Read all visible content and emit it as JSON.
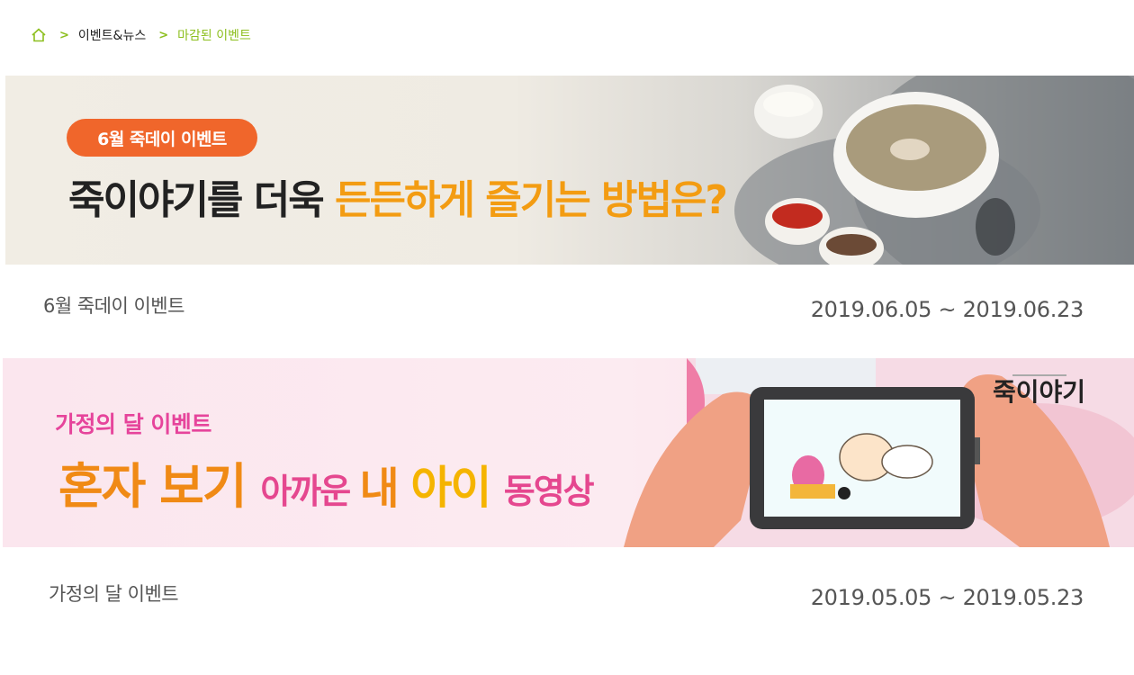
{
  "breadcrumb": {
    "home_icon": "home-icon",
    "items": [
      "이벤트&뉴스",
      "마감된 이벤트"
    ]
  },
  "events": [
    {
      "banner": {
        "pill": "6월 죽데이 이벤트",
        "headline_dark": "죽이야기를 더욱 ",
        "headline_accent": "든든하게 즐기는 방법은?"
      },
      "title": "6월 죽데이 이벤트",
      "period": "2019.06.05 ~ 2019.06.23"
    },
    {
      "banner": {
        "subtitle": "가정의 달 이벤트",
        "h1": "혼자 보기 ",
        "h2": "아까운 ",
        "h3": "내 ",
        "h4": "아이 ",
        "h5": "동영상",
        "logo": "죽이야기"
      },
      "title": "가정의 달 이벤트",
      "period": "2019.05.05 ~ 2019.05.23"
    }
  ],
  "colors": {
    "accent_green": "#8dbf1f",
    "pill_orange": "#f0662b",
    "headline_orange": "#f39c12",
    "pink": "#e6449b"
  }
}
